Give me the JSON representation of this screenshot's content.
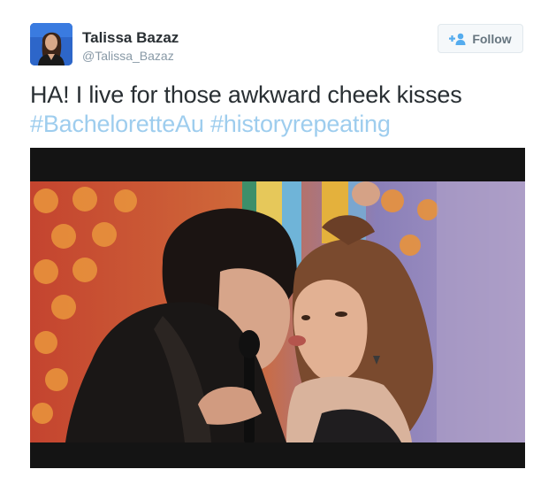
{
  "user": {
    "name": "Talissa Bazaz",
    "handle": "@Talissa_Bazaz",
    "avatar_icon": "profile-photo"
  },
  "follow_button": {
    "label": "Follow",
    "icon": "add-user-icon",
    "accent_color": "#55acee"
  },
  "tweet": {
    "text": "HA! I live for those awkward cheek kisses",
    "hashtags": [
      "#BacheloretteAu",
      "#historyrepeating"
    ],
    "hashtag_color": "#9ecdee"
  },
  "media": {
    "type": "photo",
    "letterbox_color": "#141414"
  }
}
